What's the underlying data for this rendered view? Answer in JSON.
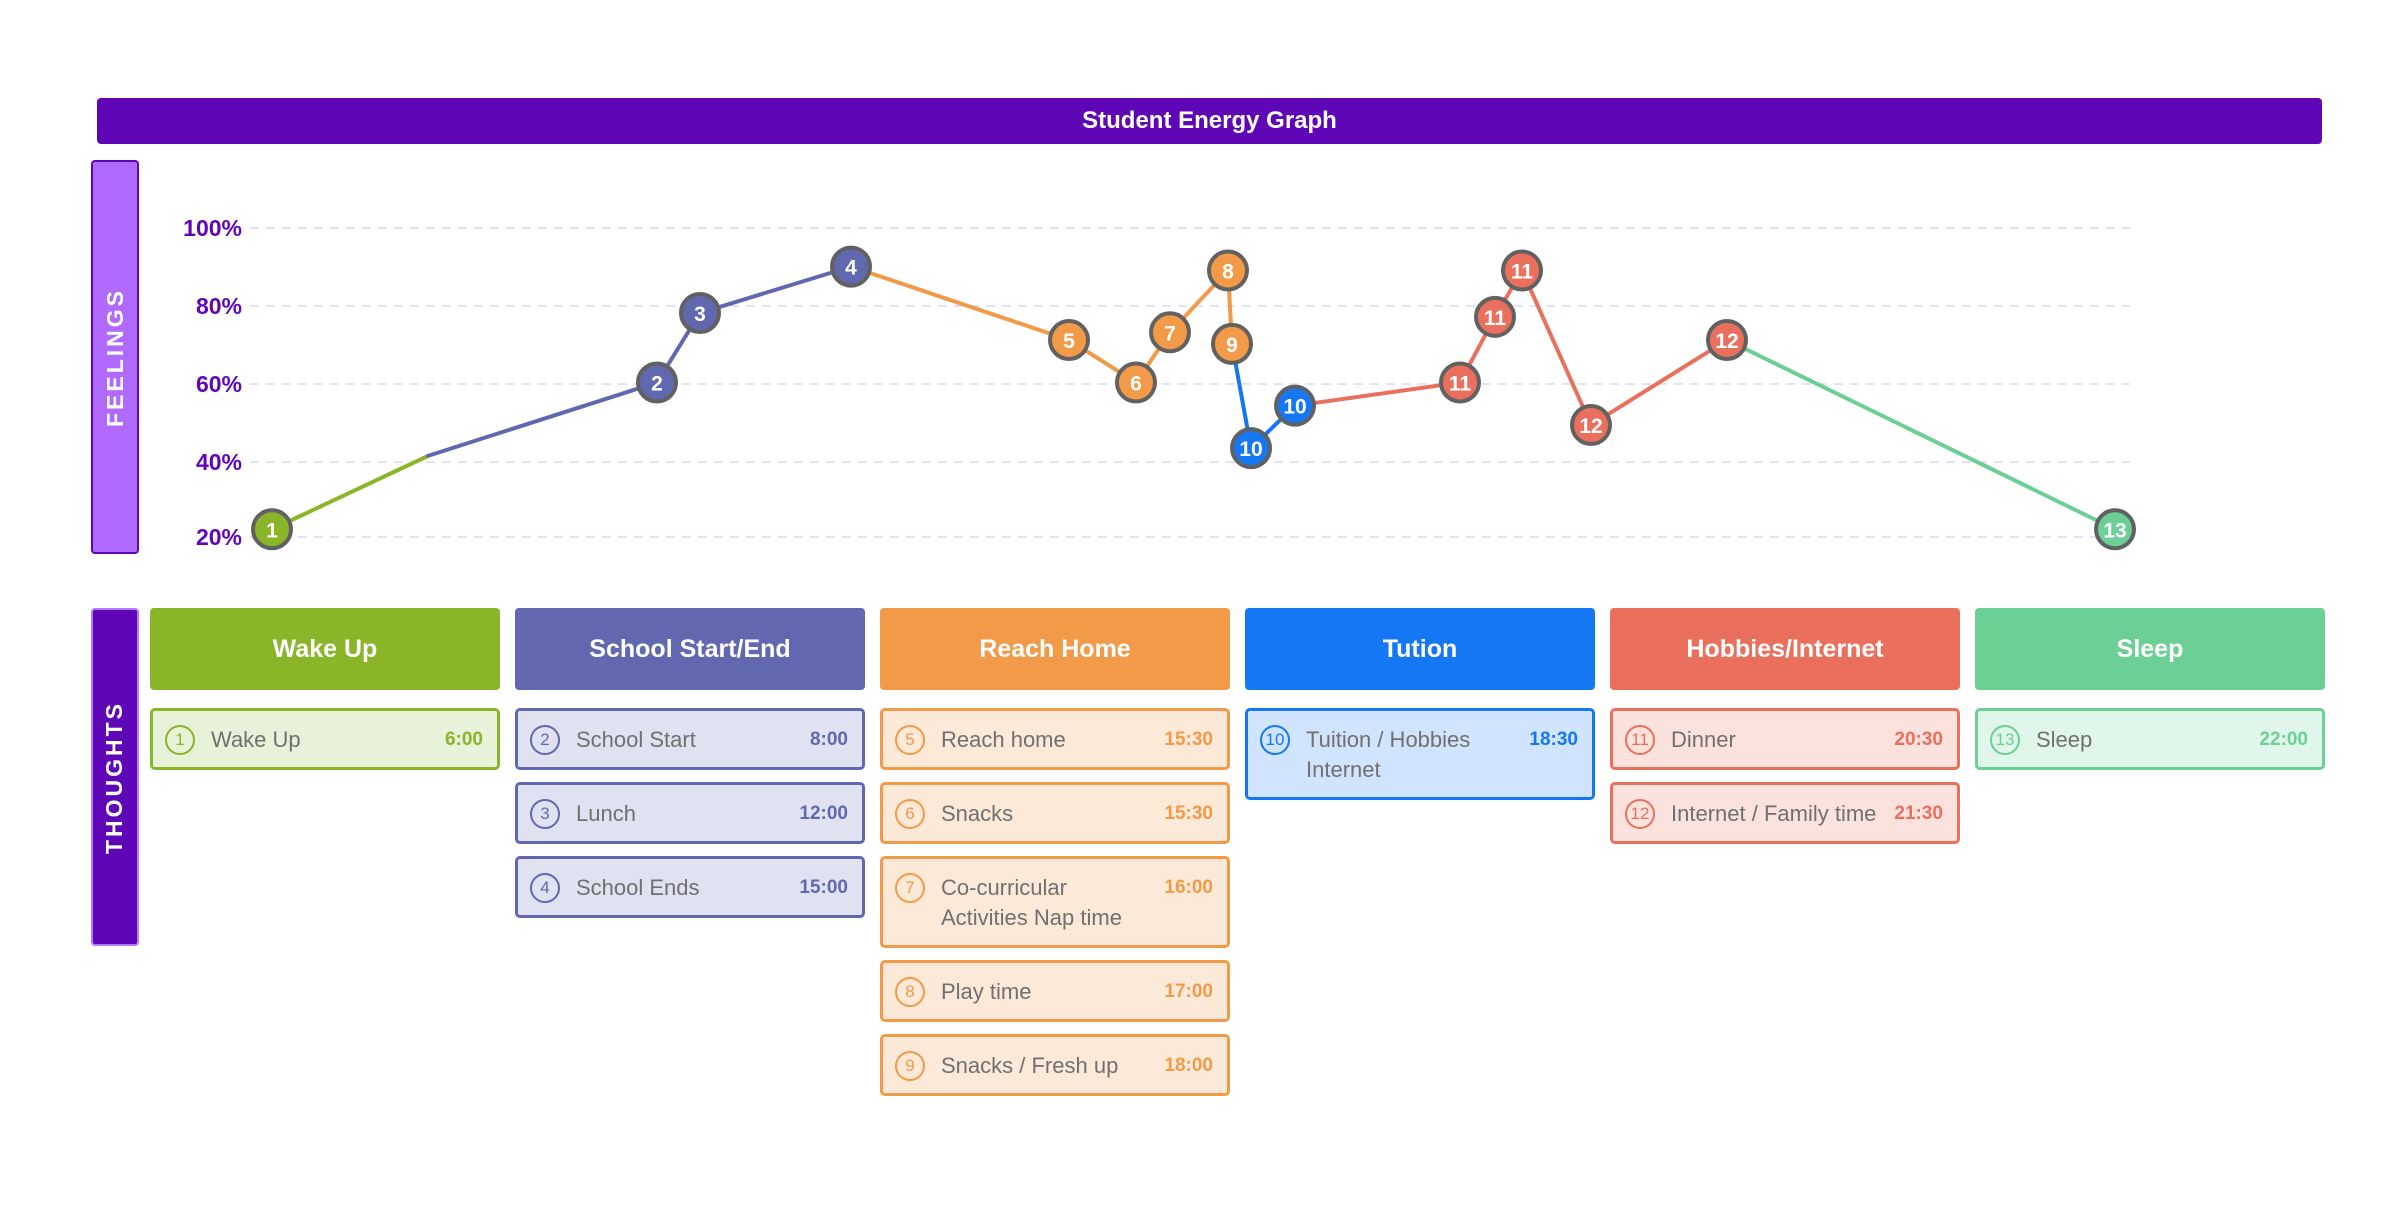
{
  "title": "Student Energy Graph",
  "side_labels": {
    "feelings": "FEELINGS",
    "thoughts": "THOUGHTS"
  },
  "colors": {
    "wake": "#8ab528",
    "school": "#6268b0",
    "home": "#f29a48",
    "tution": "#1677f5",
    "hobbies": "#ea705d",
    "sleep": "#6ccf95",
    "title_bg": "#5f07b7",
    "axis_text": "#5f07b7"
  },
  "chart_data": {
    "type": "line",
    "title": "Student Energy Graph",
    "ylabel": "",
    "y_ticks": [
      "100%",
      "80%",
      "60%",
      "40%",
      "20%"
    ],
    "ylim": [
      20,
      100
    ],
    "grid": true,
    "points": [
      {
        "label": "1",
        "value": 22,
        "group": "wake",
        "marker": true
      },
      {
        "label": "",
        "value": 41,
        "group": "wake",
        "marker": false
      },
      {
        "label": "2",
        "value": 60,
        "group": "school",
        "marker": true
      },
      {
        "label": "3",
        "value": 78,
        "group": "school",
        "marker": true
      },
      {
        "label": "4",
        "value": 90,
        "group": "school",
        "marker": true
      },
      {
        "label": "5",
        "value": 71,
        "group": "home",
        "marker": true
      },
      {
        "label": "6",
        "value": 60,
        "group": "home",
        "marker": true
      },
      {
        "label": "7",
        "value": 73,
        "group": "home",
        "marker": true
      },
      {
        "label": "8",
        "value": 89,
        "group": "home",
        "marker": true
      },
      {
        "label": "9",
        "value": 70,
        "group": "home",
        "marker": true
      },
      {
        "label": "10",
        "value": 43,
        "group": "tution",
        "marker": true
      },
      {
        "label": "10",
        "value": 54,
        "group": "tution",
        "marker": true
      },
      {
        "label": "11",
        "value": 60,
        "group": "hobbies",
        "marker": true
      },
      {
        "label": "11",
        "value": 77,
        "group": "hobbies",
        "marker": true
      },
      {
        "label": "11",
        "value": 89,
        "group": "hobbies",
        "marker": true
      },
      {
        "label": "12",
        "value": 49,
        "group": "hobbies",
        "marker": true
      },
      {
        "label": "12",
        "value": 71,
        "group": "hobbies",
        "marker": true
      },
      {
        "label": "13",
        "value": 22,
        "group": "sleep",
        "marker": true
      }
    ]
  },
  "columns": [
    {
      "key": "wake",
      "title": "Wake Up",
      "items": [
        {
          "num": "1",
          "text": "Wake Up",
          "time": "6:00"
        }
      ]
    },
    {
      "key": "school",
      "title": "School Start/End",
      "items": [
        {
          "num": "2",
          "text": "School Start",
          "time": "8:00"
        },
        {
          "num": "3",
          "text": "Lunch",
          "time": "12:00"
        },
        {
          "num": "4",
          "text": "School Ends",
          "time": "15:00"
        }
      ]
    },
    {
      "key": "home",
      "title": "Reach Home",
      "items": [
        {
          "num": "5",
          "text": "Reach home",
          "time": "15:30"
        },
        {
          "num": "6",
          "text": "Snacks",
          "time": "15:30"
        },
        {
          "num": "7",
          "text": "Co-curricular Activities Nap time",
          "time": "16:00"
        },
        {
          "num": "8",
          "text": "Play time",
          "time": "17:00"
        },
        {
          "num": "9",
          "text": "Snacks / Fresh up",
          "time": "18:00"
        }
      ]
    },
    {
      "key": "tution",
      "title": "Tution",
      "items": [
        {
          "num": "10",
          "text": "Tuition / Hobbies Internet",
          "time": "18:30"
        }
      ]
    },
    {
      "key": "hobbies",
      "title": "Hobbies/Internet",
      "items": [
        {
          "num": "11",
          "text": "Dinner",
          "time": "20:30"
        },
        {
          "num": "12",
          "text": "Internet / Family time",
          "time": "21:30"
        }
      ]
    },
    {
      "key": "sleep",
      "title": "Sleep",
      "items": [
        {
          "num": "13",
          "text": "Sleep",
          "time": "22:00"
        }
      ]
    }
  ]
}
